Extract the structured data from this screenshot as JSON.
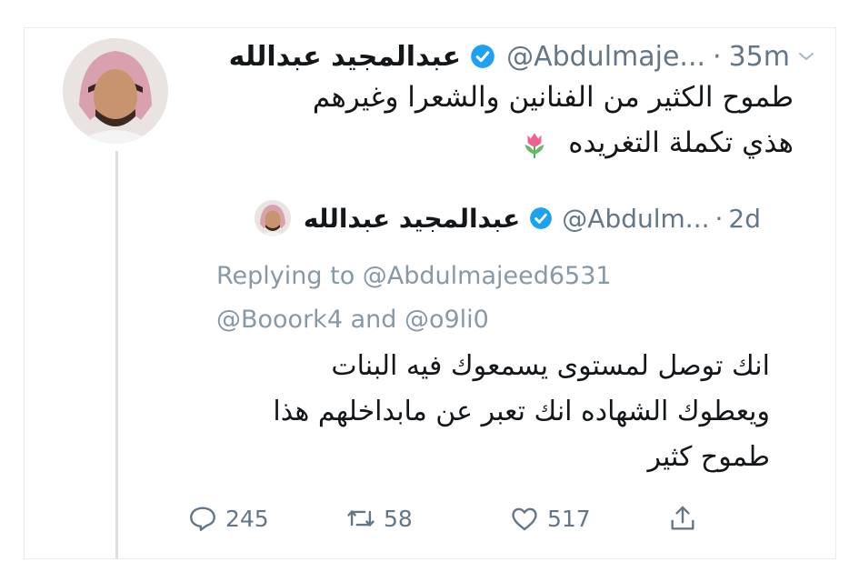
{
  "tweet": {
    "author_name": "عبدالمجيد عبدالله",
    "handle": "@Abdulmaje...",
    "separator": "·",
    "time": "35m",
    "text_line1": "طموح الكثير من الفنانين والشعرا وغيرهم",
    "text_line2": "هذي تكملة التغريده",
    "emoji": "tulip",
    "verified_icon": "verified-badge-icon",
    "chevron_icon": "chevron-down-icon"
  },
  "quoted_tweet": {
    "author_name": "عبدالمجيد عبدالله",
    "handle": "@Abdulm...",
    "separator": "·",
    "time": "2d",
    "replying_line1": "Replying to @Abdulmajeed6531",
    "replying_line2": "@Booork4 and @o9li0",
    "text_line1": "انك توصل لمستوى يسمعوك فيه البنات",
    "text_line2": "ويعطوك الشهاده انك تعبر عن مابداخلهم هذا",
    "text_line3": "طموح كثير"
  },
  "actions": {
    "reply_count": "245",
    "retweet_count": "58",
    "like_count": "517",
    "icons": [
      "reply-icon",
      "retweet-icon",
      "like-icon",
      "share-icon"
    ]
  },
  "colors": {
    "text": "#14171a",
    "muted": "#657786",
    "replying": "#8899a6",
    "verified": "#1da1f2",
    "thread_line": "#d9dfe3"
  }
}
